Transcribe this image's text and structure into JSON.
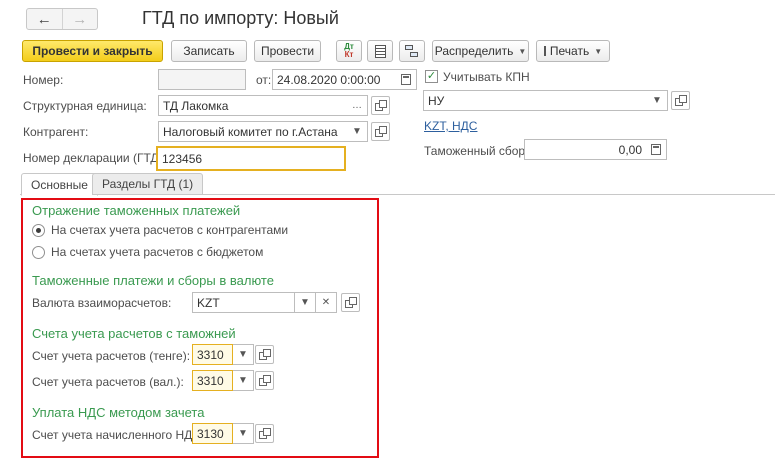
{
  "window": {
    "title": "ГТД по импорту: Новый"
  },
  "nav": {
    "back_icon": "arrow-left-icon",
    "forward_icon": "arrow-right-icon"
  },
  "toolbar": {
    "post_close": "Провести и закрыть",
    "save": "Записать",
    "post": "Провести",
    "dt_kt_top": "Дт",
    "dt_kt_bottom": "Кт",
    "distribute": "Распределить",
    "print": "Печать"
  },
  "form": {
    "number_label": "Номер:",
    "number_value": "",
    "date_label": "от:",
    "date_value": "24.08.2020  0:00:00",
    "kpn_label": "Учитывать КПН",
    "kpn_checked": true,
    "unit_label": "Структурная единица:",
    "unit_value": "ТД Лакомка",
    "nu_value": "НУ",
    "contractor_label": "Контрагент:",
    "contractor_value": "Налоговый комитет по г.Астана",
    "vat_link": "KZT, НДС",
    "declaration_label": "Номер декларации (ГТД):",
    "declaration_value": "123456",
    "customs_fee_label": "Таможенный сбор:",
    "customs_fee_value": "0,00"
  },
  "tabs": [
    {
      "label": "Основные",
      "active": true
    },
    {
      "label": "Разделы ГТД (1)",
      "active": false
    }
  ],
  "main": {
    "sec1_title": "Отражение таможенных платежей",
    "radio1": "На счетах учета расчетов с контрагентами",
    "radio2": "На счетах учета расчетов с бюджетом",
    "radio_selected": 1,
    "sec2_title": "Таможенные платежи и сборы в валюте",
    "currency_label": "Валюта взаиморасчетов:",
    "currency_value": "KZT",
    "sec3_title": "Счета учета расчетов с таможней",
    "acc_tenge_label": "Счет учета расчетов (тенге):",
    "acc_tenge_value": "3310",
    "acc_val_label": "Счет учета расчетов (вал.):",
    "acc_val_value": "3310",
    "sec4_title": "Уплата НДС методом зачета",
    "vat_acc_label": "Счет учета начисленного НДС:",
    "vat_acc_value": "3130"
  },
  "colors": {
    "accent_yellow": "#f3cd1a",
    "section_green": "#3a9a50",
    "highlight_red": "#e30c14",
    "link_blue": "#2d5f9e"
  }
}
